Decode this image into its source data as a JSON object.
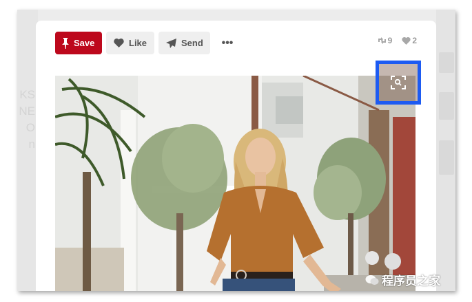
{
  "toolbar": {
    "save_label": "Save",
    "like_label": "Like",
    "send_label": "Send",
    "more_label": "•••"
  },
  "stats": {
    "repins": "9",
    "likes": "2"
  },
  "background_text": [
    "KS",
    "NE",
    "O",
    "n"
  ],
  "watermark": {
    "text": "程序员之家"
  },
  "colors": {
    "save_button": "#bd081c",
    "secondary_button": "#efefef",
    "visual_search_highlight": "#1d5bf2"
  },
  "icons": {
    "save": "pushpin-icon",
    "like": "heart-icon",
    "send": "paper-plane-icon",
    "repins": "pin-count-icon",
    "likes": "heart-count-icon",
    "visual_search": "visual-search-icon"
  }
}
